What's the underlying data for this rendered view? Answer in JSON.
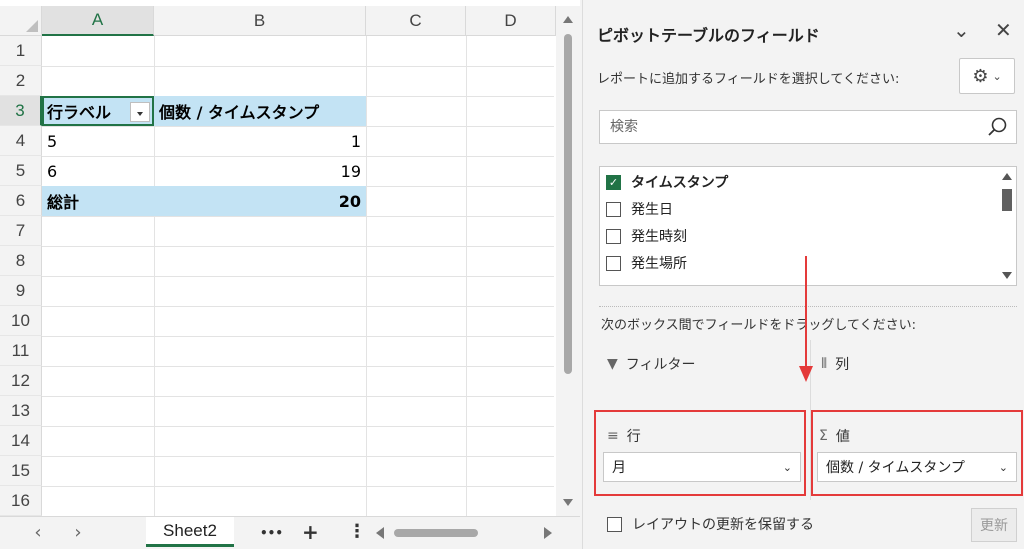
{
  "sheet": {
    "columns": [
      "A",
      "B",
      "C",
      "D"
    ],
    "rows": [
      "1",
      "2",
      "3",
      "4",
      "5",
      "6",
      "7",
      "8",
      "9",
      "10",
      "11",
      "12",
      "13",
      "14",
      "15",
      "16"
    ],
    "pivot": {
      "header_row_label": "行ラベル",
      "header_value": "個数 / タイムスタンプ",
      "rows": [
        {
          "label": "5",
          "value": "1"
        },
        {
          "label": "6",
          "value": "19"
        }
      ],
      "total_label": "総計",
      "total_value": "20"
    },
    "accent_color": "#217346",
    "pivot_header_color": "#c3e3f4"
  },
  "tabbar": {
    "prev_icon": "‹",
    "next_icon": "›",
    "sheet_tab": "Sheet2",
    "more_icon": "•••",
    "add_icon": "+",
    "options_icon": "⋮"
  },
  "pane": {
    "title": "ピボットテーブルのフィールド",
    "subtitle": "レポートに追加するフィールドを選択してください:",
    "search_placeholder": "検索",
    "fields": [
      {
        "label": "タイムスタンプ",
        "checked": true
      },
      {
        "label": "発生日",
        "checked": false
      },
      {
        "label": "発生時刻",
        "checked": false
      },
      {
        "label": "発生場所",
        "checked": false
      }
    ],
    "drag_hint": "次のボックス間でフィールドをドラッグしてください:",
    "areas": {
      "filter": "フィルター",
      "columns": "列",
      "rows": "行",
      "values": "値"
    },
    "rows_value": "月",
    "values_value": "個数 / タイムスタンプ",
    "defer_label": "レイアウトの更新を保留する",
    "update_button": "更新",
    "highlight_color": "#e43a3a"
  }
}
